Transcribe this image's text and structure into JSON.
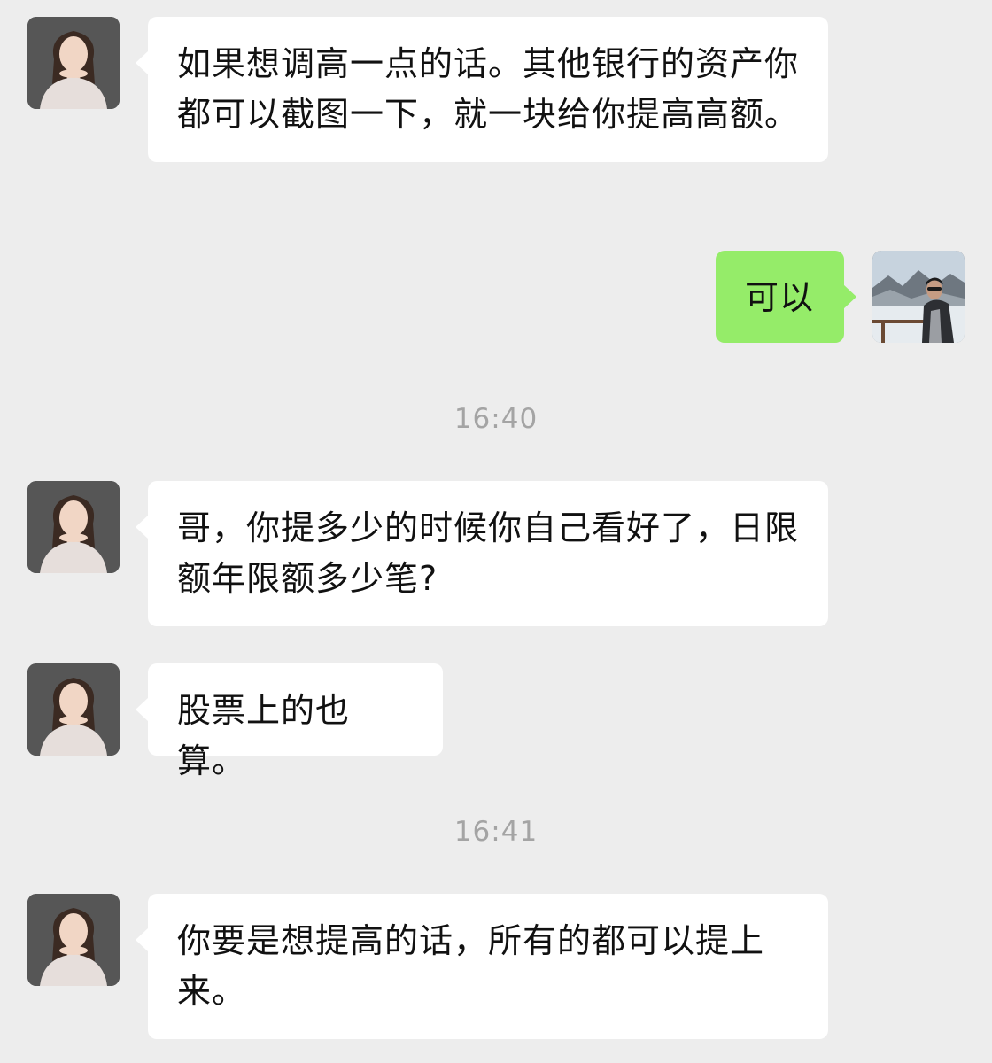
{
  "chat": {
    "timestamps": [
      "16:40",
      "16:41"
    ],
    "messages": [
      {
        "side": "left",
        "text": "如果想调高一点的话。其他银行的资产你都可以截图一下，就一块给你提高高额。"
      },
      {
        "side": "right",
        "text": "可以"
      },
      {
        "side": "left",
        "text": "哥，你提多少的时候你自己看好了，日限额年限额多少笔?"
      },
      {
        "side": "left",
        "text": "股票上的也算。"
      },
      {
        "side": "left",
        "text": "你要是想提高的话，所有的都可以提上来。"
      }
    ]
  },
  "colors": {
    "background": "#ededed",
    "incoming_bubble": "#ffffff",
    "outgoing_bubble": "#95ec69",
    "timestamp_text": "#a4a4a4",
    "message_text": "#111111"
  }
}
